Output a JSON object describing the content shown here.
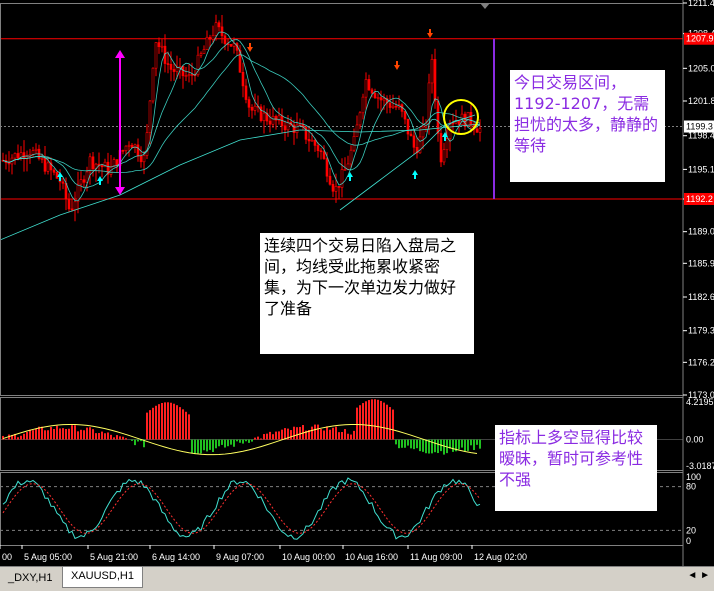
{
  "colors": {
    "background": "#000000",
    "candle": "#ff0000",
    "ma": "#40e0d0",
    "level_line": "#ff0000",
    "range_bar": "#8a2be2",
    "arrow_up": "#00ffff",
    "arrow_down": "#ff4500",
    "circle": "#ffff00",
    "axis_text": "#ffffff"
  },
  "price_axis": {
    "ticks": [
      "1211.4",
      "1208.4",
      "1205.0",
      "1201.8",
      "1198.4",
      "1195.1",
      "1192.2",
      "1189.0",
      "1185.9",
      "1182.6",
      "1179.3",
      "1176.2",
      "1173.0"
    ],
    "current_label": "1199.3",
    "upper_level_label": "1207.9",
    "lower_level_label": "1192.2"
  },
  "indicator_axis": {
    "ticks": [
      "4.2195",
      "0.00",
      "-3.0187"
    ]
  },
  "stoch_axis": {
    "ticks": [
      "100",
      "80",
      "20",
      "0"
    ]
  },
  "time_axis": {
    "labels": [
      "00",
      "5 Aug 05:00",
      "5 Aug 21:00",
      "6 Aug 14:00",
      "9 Aug 07:00",
      "10 Aug 00:00",
      "10 Aug 16:00",
      "11 Aug 09:00",
      "12 Aug 02:00"
    ]
  },
  "annotations": {
    "range_note": "今日交易区间，1192-1207，无需担忧的太多，静静的等待",
    "ma_note": "连续四个交易日陷入盘局之间，均线受此拖累收紧密集，为下一次单边发力做好了准备",
    "indicator_note": "指标上多空显得比较暧昧，暂时可参考性不强"
  },
  "tabs": [
    {
      "label": "_DXY,H1",
      "active": false
    },
    {
      "label": "XAUUSD,H1",
      "active": true
    }
  ],
  "tab_arrows": "◄ ►"
}
